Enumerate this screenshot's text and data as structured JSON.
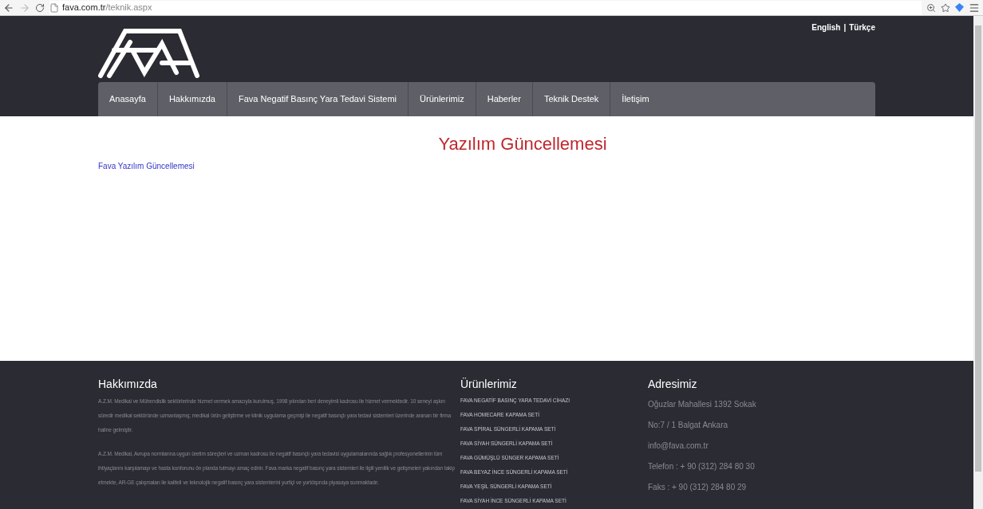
{
  "browser": {
    "url_host": "fava.com.tr",
    "url_path": "/teknik.aspx"
  },
  "header": {
    "languages": [
      {
        "label": "English"
      },
      {
        "label": "Türkçe"
      }
    ],
    "separator": "|",
    "nav": [
      {
        "label": "Anasayfa"
      },
      {
        "label": "Hakkımızda"
      },
      {
        "label": "Fava Negatif Basınç Yara Tedavi Sistemi"
      },
      {
        "label": "Ürünlerimiz"
      },
      {
        "label": "Haberler"
      },
      {
        "label": "Teknik Destek"
      },
      {
        "label": "İletişim"
      }
    ]
  },
  "content": {
    "title": "Yazılım Güncellemesi",
    "links": [
      "Fava Yazılım Güncellemesi"
    ]
  },
  "footer": {
    "about": {
      "heading": "Hakkımızda",
      "paragraphs": [
        "A.Z.M. Medikal ve Mühendislik sektörlerinde hizmet vermek amacıyla kurulmuş, 1998 yılından beri deneyimli kadrosu ile hizmet vermektedir. 10 seneyi aşkın süredir medikal sektöründe uzmanlaşmış; medikal ürün geliştirme ve klinik uygulama geçmişi ile negatif basınçlı yara tedavi sistemleri üzerinde aranan bir firma haline gelmiştir.",
        "A.Z.M. Medikal, Avrupa normlarına uygun üretim süreçleri ve uzman kadrosu ile negatif basınçlı yara tedavisi uygulamalarında sağlık profesyonellerinin tüm ihtiyaçlarını karşılamayı ve hasta konforunu ön planda tutmayı amaç edinir. Fava marka negatif basınç yara sistemleri ile ilgili yenilik ve gelişmeleri yakından takip etmekte, AR-GE çalışmaları ile kaliteli ve teknolojik negatif basınç yara sistemlerini yurtiçi ve yurtdışında piyasaya sunmaktadır."
      ]
    },
    "products": {
      "heading": "Ürünlerimiz",
      "items": [
        "FAVA NEGATİF BASINÇ YARA TEDAVİ CİHAZI",
        "FAVA HOMECARE KAPAMA SETİ",
        "FAVA SPİRAL SÜNGERLİ KAPAMA SETİ",
        "FAVA SİYAH SÜNGERLİ KAPAMA SETİ",
        "FAVA GÜMÜŞLÜ SÜNGER KAPAMA SETİ",
        "FAVA BEYAZ İNCE SÜNGERLİ KAPAMA SETİ",
        "FAVA YEŞİL SÜNGERLİ KAPAMA SETİ",
        "FAVA SİYAH İNCE SÜNGERLİ KAPAMA SETİ"
      ]
    },
    "address": {
      "heading": "Adresimiz",
      "lines": [
        "Oğuzlar Mahallesi 1392 Sokak",
        "No:7 / 1 Balgat Ankara",
        "info@fava.com.tr",
        "Telefon : + 90 (312) 284 80 30",
        "Faks : + 90 (312) 284 80 29"
      ]
    }
  }
}
